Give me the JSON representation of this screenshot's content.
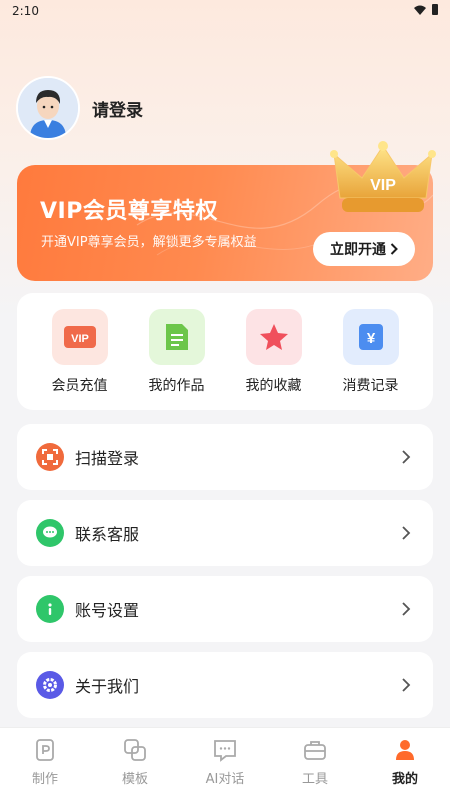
{
  "status_bar": {
    "time": "2:10"
  },
  "profile": {
    "login_text": "请登录"
  },
  "vip_banner": {
    "title": "VIP会员尊享特权",
    "subtitle": "开通VIP尊享会员，解锁更多专属权益",
    "button_label": "立即开通",
    "badge_text": "VIP"
  },
  "quick_actions": [
    {
      "label": "会员充值",
      "icon": "vip-card-icon",
      "icon_text": "VIP"
    },
    {
      "label": "我的作品",
      "icon": "document-icon"
    },
    {
      "label": "我的收藏",
      "icon": "star-icon"
    },
    {
      "label": "消费记录",
      "icon": "yuan-receipt-icon",
      "icon_text": "¥"
    }
  ],
  "menu": [
    {
      "label": "扫描登录",
      "icon": "scan-icon"
    },
    {
      "label": "联系客服",
      "icon": "chat-icon"
    },
    {
      "label": "账号设置",
      "icon": "info-icon"
    },
    {
      "label": "关于我们",
      "icon": "gear-icon"
    }
  ],
  "tabbar": [
    {
      "label": "制作",
      "icon": "create-icon",
      "active": false
    },
    {
      "label": "模板",
      "icon": "template-icon",
      "active": false
    },
    {
      "label": "AI对话",
      "icon": "ai-chat-icon",
      "active": false
    },
    {
      "label": "工具",
      "icon": "toolbox-icon",
      "active": false
    },
    {
      "label": "我的",
      "icon": "profile-icon",
      "active": true
    }
  ],
  "colors": {
    "accent": "#ff7a3d",
    "active_tab": "#ff6a2b",
    "inactive": "#999999"
  }
}
